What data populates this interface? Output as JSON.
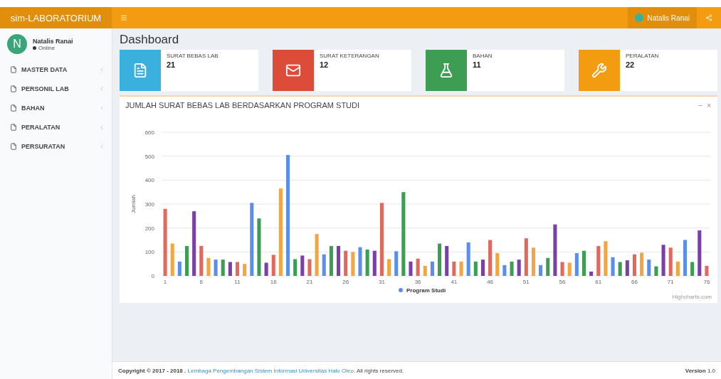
{
  "header": {
    "logo": "sim-LABORATORIUM",
    "user_name": "Natalis Ranai"
  },
  "sidebar": {
    "user": {
      "initial": "N",
      "name": "Natalis Ranai",
      "status": "Online"
    },
    "items": [
      {
        "label": "MASTER DATA"
      },
      {
        "label": "PERSONIL LAB"
      },
      {
        "label": "BAHAN"
      },
      {
        "label": "PERALATAN"
      },
      {
        "label": "PERSURATAN"
      }
    ]
  },
  "page_title": "Dashboard",
  "info_boxes": [
    {
      "kind": "pdf",
      "label": "SURAT BEBAS LAB",
      "value": "21",
      "color": "#3ab0de"
    },
    {
      "kind": "mail",
      "label": "SURAT KETERANGAN",
      "value": "12",
      "color": "#dd4b39"
    },
    {
      "kind": "flask",
      "label": "BAHAN",
      "value": "11",
      "color": "#3d9d52"
    },
    {
      "kind": "wrench",
      "label": "PERALATAN",
      "value": "22",
      "color": "#f39c12"
    }
  ],
  "chart_box": {
    "title": "JUMLAH SURAT BEBAS LAB BERDASARKAN PROGRAM STUDI",
    "tools": [
      "−",
      "×"
    ],
    "credits": "Highcharts.com",
    "chart_data": {
      "type": "bar",
      "ylabel": "Jumlah",
      "ylim": [
        0,
        600
      ],
      "yticks": [
        0,
        100,
        200,
        300,
        400,
        500,
        600
      ],
      "grid": true,
      "xlim": [
        0.5,
        76.5
      ],
      "x": [
        1,
        2,
        3,
        4,
        5,
        6,
        7,
        8,
        9,
        10,
        11,
        12,
        13,
        14,
        15,
        16,
        17,
        18,
        19,
        20,
        21,
        22,
        23,
        24,
        25,
        26,
        27,
        28,
        29,
        30,
        31,
        32,
        33,
        34,
        35,
        36,
        37,
        38,
        39,
        40,
        41,
        42,
        43,
        44,
        45,
        46,
        47,
        48,
        49,
        50,
        51,
        52,
        53,
        54,
        55,
        56,
        57,
        58,
        59,
        60,
        61,
        62,
        63,
        64,
        65,
        66,
        67,
        68,
        69,
        70,
        71,
        72,
        73,
        74,
        75,
        76
      ],
      "xticks": [
        1,
        6,
        11,
        16,
        21,
        26,
        31,
        36,
        41,
        46,
        51,
        56,
        61,
        66,
        71,
        76
      ],
      "series": [
        {
          "name": "Program Studi",
          "values": [
            280,
            135,
            60,
            125,
            270,
            125,
            75,
            68,
            68,
            58,
            58,
            50,
            305,
            240,
            55,
            88,
            365,
            505,
            70,
            85,
            70,
            175,
            90,
            125,
            125,
            105,
            100,
            120,
            110,
            105,
            305,
            70,
            103,
            350,
            60,
            72,
            42,
            60,
            135,
            125,
            60,
            60,
            140,
            60,
            68,
            150,
            95,
            45,
            60,
            68,
            157,
            118,
            45,
            75,
            215,
            58,
            55,
            95,
            105,
            18,
            125,
            145,
            78,
            58,
            65,
            90,
            97,
            68,
            40,
            130,
            118,
            60,
            150,
            58,
            190,
            42
          ]
        }
      ]
    }
  },
  "footer": {
    "copyright": "Copyright © 2017 - 2018 . ",
    "link": "Lembaga Pengembangan Sistem Informasi Universitas Halu Oleo",
    "rest": ". All rights reserved.",
    "version_label": "Version",
    "version": "1.0"
  }
}
